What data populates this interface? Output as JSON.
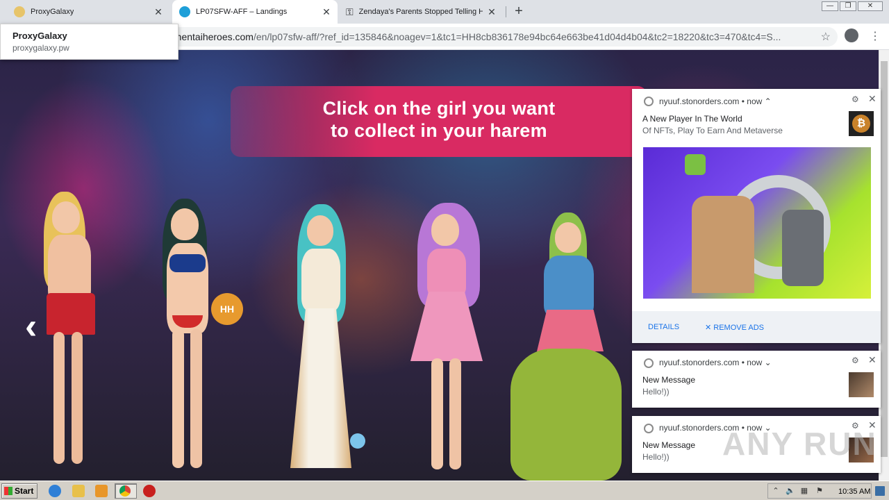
{
  "browser": {
    "tabs": [
      {
        "title": "ProxyGalaxy",
        "active": false
      },
      {
        "title": "LP07SFW-AFF – Landings",
        "active": true
      },
      {
        "title": "Zendaya's Parents Stopped Telling H",
        "active": false
      }
    ],
    "address": {
      "host": "g.hentaiheroes.com",
      "path": "/en/lp07sfw-aff/?ref_id=135846&noagev=1&tc1=HH8cb836178e94bc64e663be41d04d4b04&tc2=18220&tc3=470&tc4=S..."
    },
    "dropdown": {
      "title": "ProxyGalaxy",
      "subtitle": "proxygalaxy.pw"
    }
  },
  "page": {
    "banner_line1": "Click on the girl you want",
    "banner_line2": "to collect in your harem",
    "ball_label": "HH"
  },
  "notifications": [
    {
      "site": "nyuuf.stonorders.com",
      "time": "now",
      "title": "A New Player In The World",
      "body": "Of NFTs, Play To Earn And Metaverse",
      "actions": {
        "details": "DETAILS",
        "remove": "REMOVE ADS"
      }
    },
    {
      "site": "nyuuf.stonorders.com",
      "time": "now",
      "title": "New Message",
      "body": "Hello!))"
    },
    {
      "site": "nyuuf.stonorders.com",
      "time": "now",
      "title": "New Message",
      "body": "Hello!))"
    }
  ],
  "taskbar": {
    "start_label": "Start",
    "clock": "10:35 AM"
  },
  "watermark": "ANY RUN",
  "colors": {
    "banner": "#d92a62",
    "link_blue": "#1a73e8",
    "tab_bg": "#dee1e6"
  }
}
